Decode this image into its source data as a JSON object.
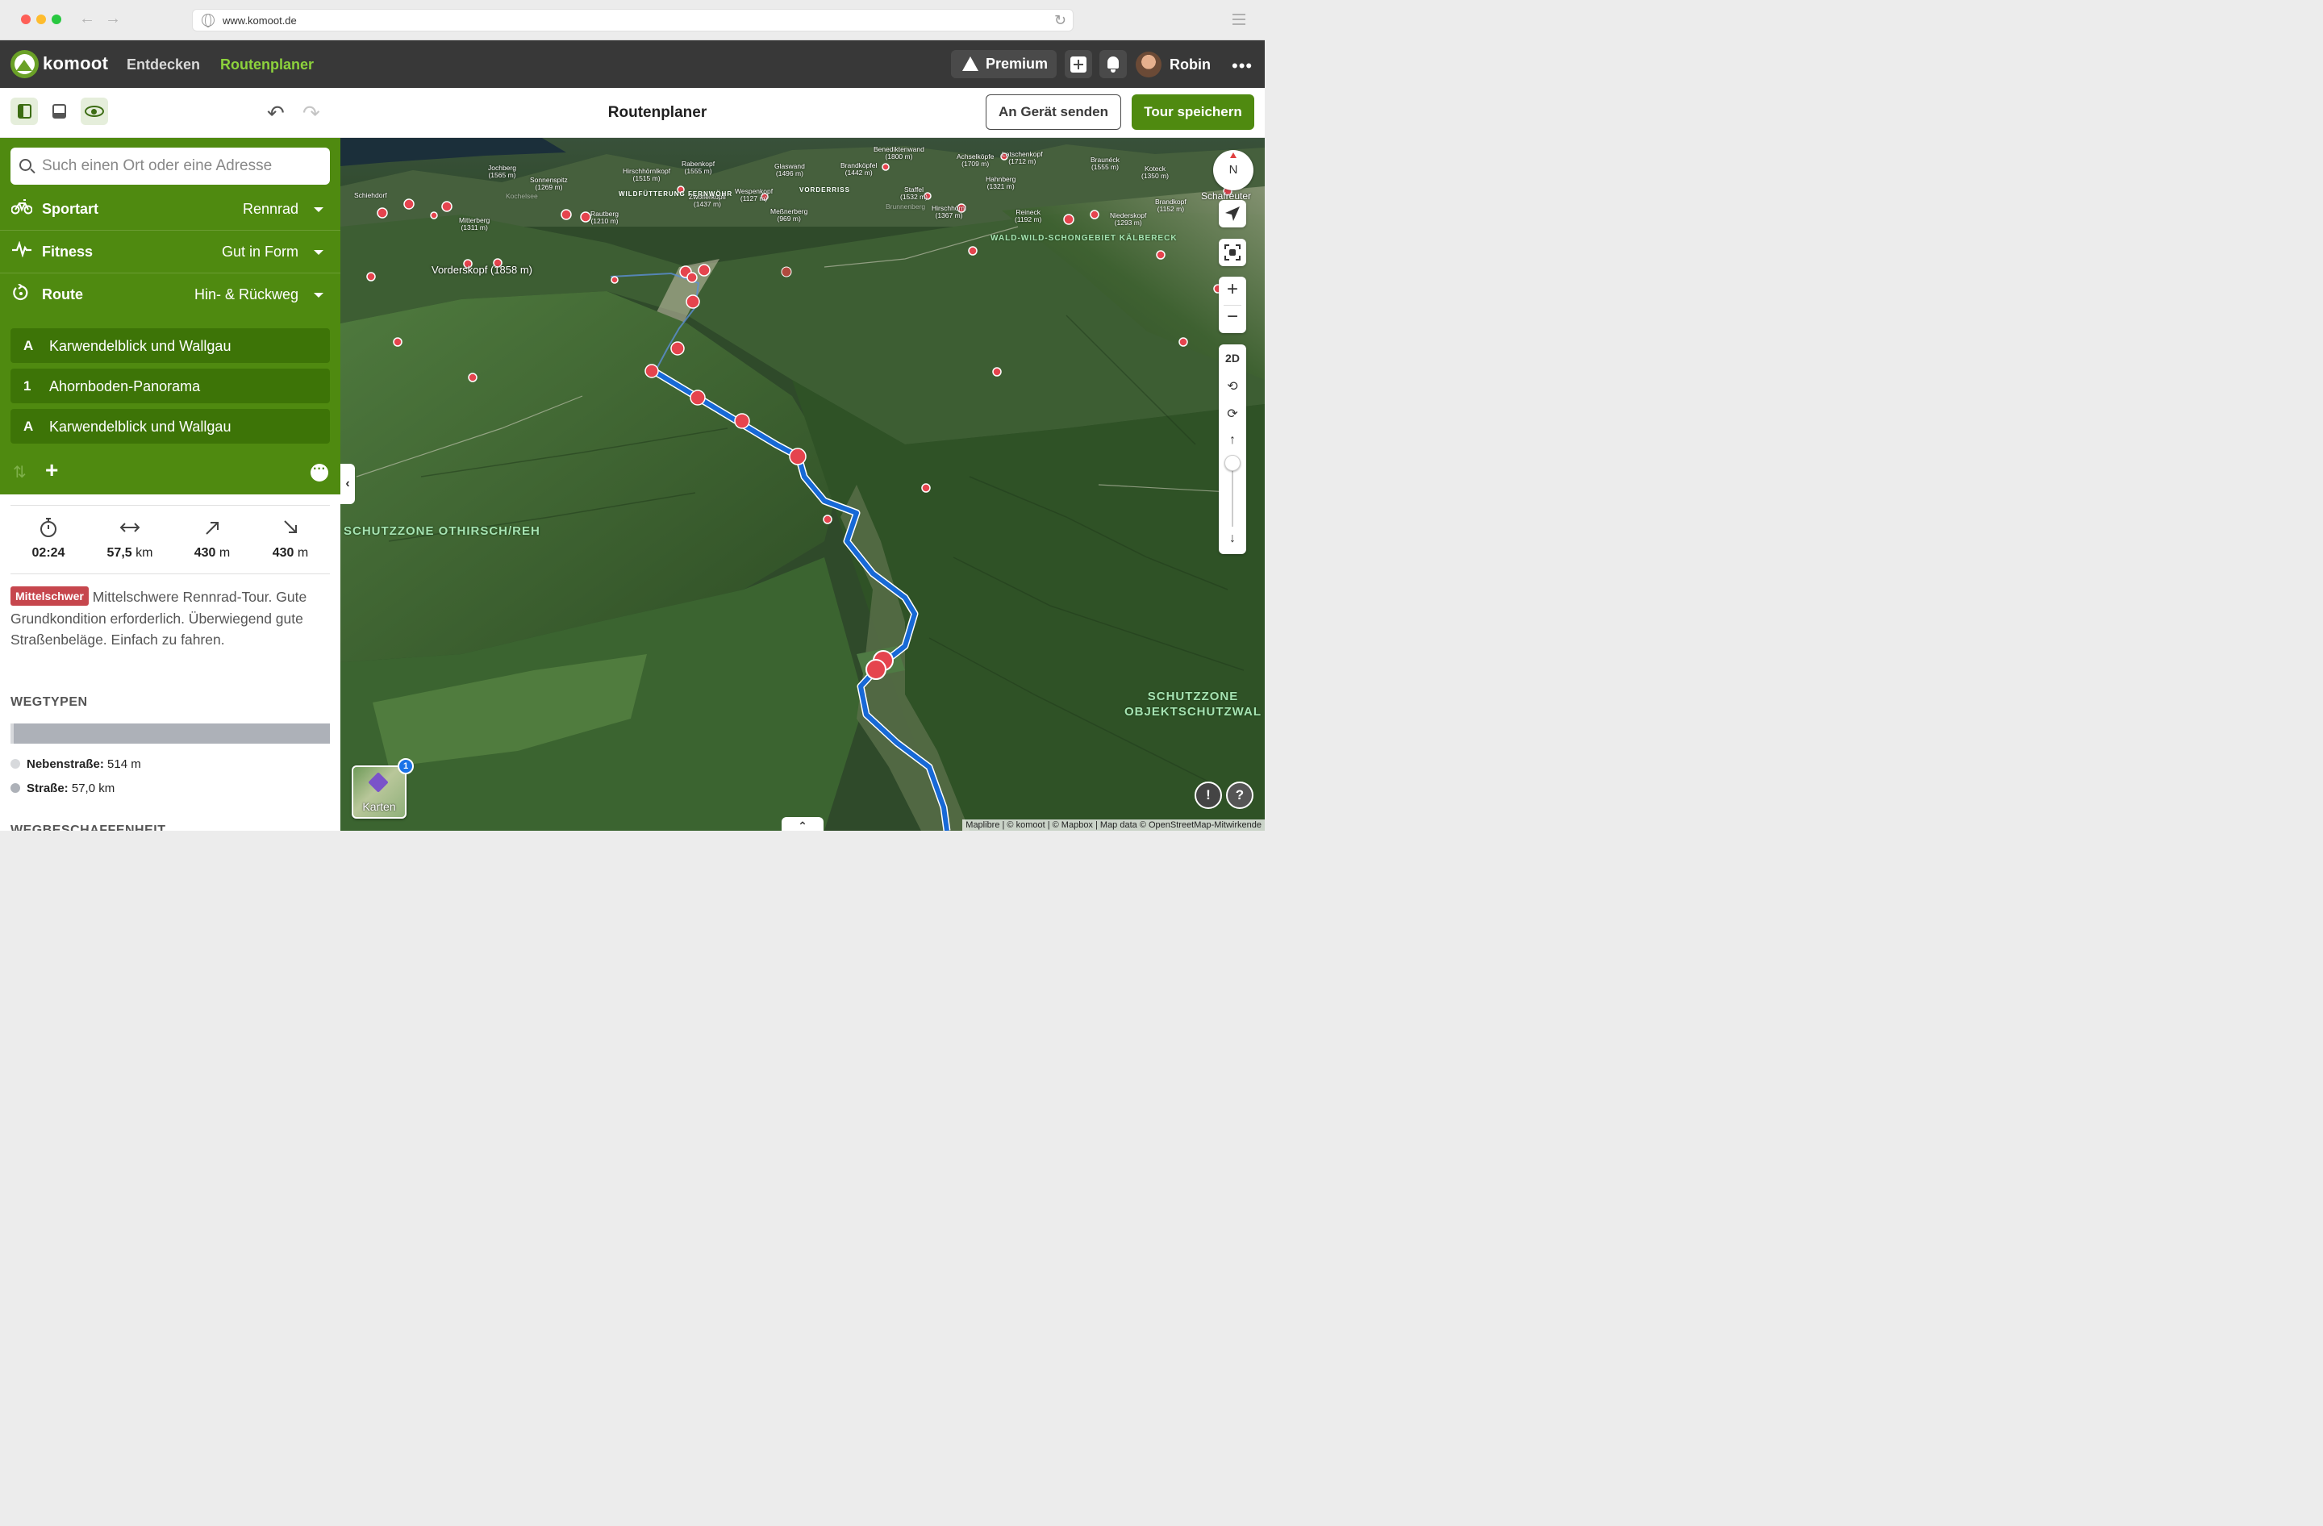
{
  "browser": {
    "url": "www.komoot.de"
  },
  "header": {
    "brand": "komoot",
    "nav": [
      "Entdecken",
      "Routenplaner"
    ],
    "premium_label": "Premium",
    "user_name": "Robin",
    "colors": {
      "brand_green": "#6aa127",
      "active_nav": "#8dd23c",
      "bar_bg": "#383838"
    }
  },
  "toolbar": {
    "title": "Routenplaner",
    "send_label": "An Gerät senden",
    "save_label": "Tour speichern"
  },
  "sidebar": {
    "search": {
      "placeholder": "Such einen Ort oder eine Adresse",
      "value": ""
    },
    "options": [
      {
        "icon": "bike-icon",
        "label": "Sportart",
        "value": "Rennrad"
      },
      {
        "icon": "pulse-icon",
        "label": "Fitness",
        "value": "Gut in Form"
      },
      {
        "icon": "loop-icon",
        "label": "Route",
        "value": "Hin- & Rückweg"
      }
    ],
    "waypoints": [
      {
        "tag": "A",
        "name": "Karwendelblick und Wallgau"
      },
      {
        "tag": "1",
        "name": "Ahornboden-Panorama"
      },
      {
        "tag": "A",
        "name": "Karwendelblick und Wallgau"
      }
    ],
    "stats": [
      {
        "icon": "stopwatch-icon",
        "value": "02:24",
        "unit": ""
      },
      {
        "icon": "distance-icon",
        "value": "57,5",
        "unit": "km"
      },
      {
        "icon": "uphill-icon",
        "value": "430",
        "unit": "m"
      },
      {
        "icon": "downhill-icon",
        "value": "430",
        "unit": "m"
      }
    ],
    "difficulty_badge": "Mittelschwer",
    "difficulty_text": "Mittelschwere Rennrad-Tour. Gute Grundkondition erforderlich. Überwiegend gute Straßenbeläge. Einfach zu fahren.",
    "waytypes_heading": "WEGTYPEN",
    "waytypes": [
      {
        "label": "Nebenstraße:",
        "value": "514 m",
        "color": "#d7d9dc",
        "fraction": 0.009
      },
      {
        "label": "Straße:",
        "value": "57,0 km",
        "color": "#adb1b8",
        "fraction": 0.991
      }
    ],
    "surface_heading": "WEGBESCHAFFENHEIT",
    "accent_color": "#4f8a10"
  },
  "map": {
    "compass_label": "N",
    "mode_2d": "2D",
    "layers_label": "Karten",
    "layers_badge": "1",
    "attribution": "Maplibre | © komoot | © Mapbox | Map data © OpenStreetMap-Mitwirkende",
    "route_color": "#1769d6",
    "poi_color": "#e5444e",
    "zones": [
      {
        "text": "SCHUTZZONE\nOTHIRSCH/REH"
      },
      {
        "text": "SCHUTZZONE\nOBJEKTSCHUTZWAL"
      },
      {
        "text": "WALD-WILD-SCHONGEBIET\nKÄLBERECK"
      },
      {
        "text": "WILDFÜTTERUNG\nFERNWÖHR"
      },
      {
        "text": "VORDERRISS"
      }
    ],
    "main_peak": "Vorderskopf\n(1858 m)",
    "peaks": [
      "Jochberg\n(1565 m)",
      "Sonnenspitz\n(1269 m)",
      "Hirschhörnlkopf\n(1515 m)",
      "Rabenkopf\n(1555 m)",
      "Glaswand\n(1496 m)",
      "Brandköpfel\n(1442 m)",
      "Benediktenwand\n(1800 m)",
      "Achselköpfe\n(1709 m)",
      "Latschenkopf\n(1712 m)",
      "Braunéck\n(1555 m)",
      "Koteck\n(1350 m)",
      "Hahnberg\n(1321 m)",
      "Mitterberg\n(1311 m)",
      "Rautberg\n(1210 m)",
      "Zwölferköpfl\n(1437 m)",
      "Wespenkopf\n(1127 m)",
      "Meßnerberg\n(969 m)",
      "Staffel\n(1532 m)",
      "Hirschhörnl\n(1367 m)",
      "Reineck\n(1192 m)",
      "Niederskopf\n(1293 m)",
      "Brandkopf\n(1152 m)",
      "Schafreuter",
      "Schiehdorf",
      "Brunnenberg",
      "Kochelsee"
    ]
  }
}
